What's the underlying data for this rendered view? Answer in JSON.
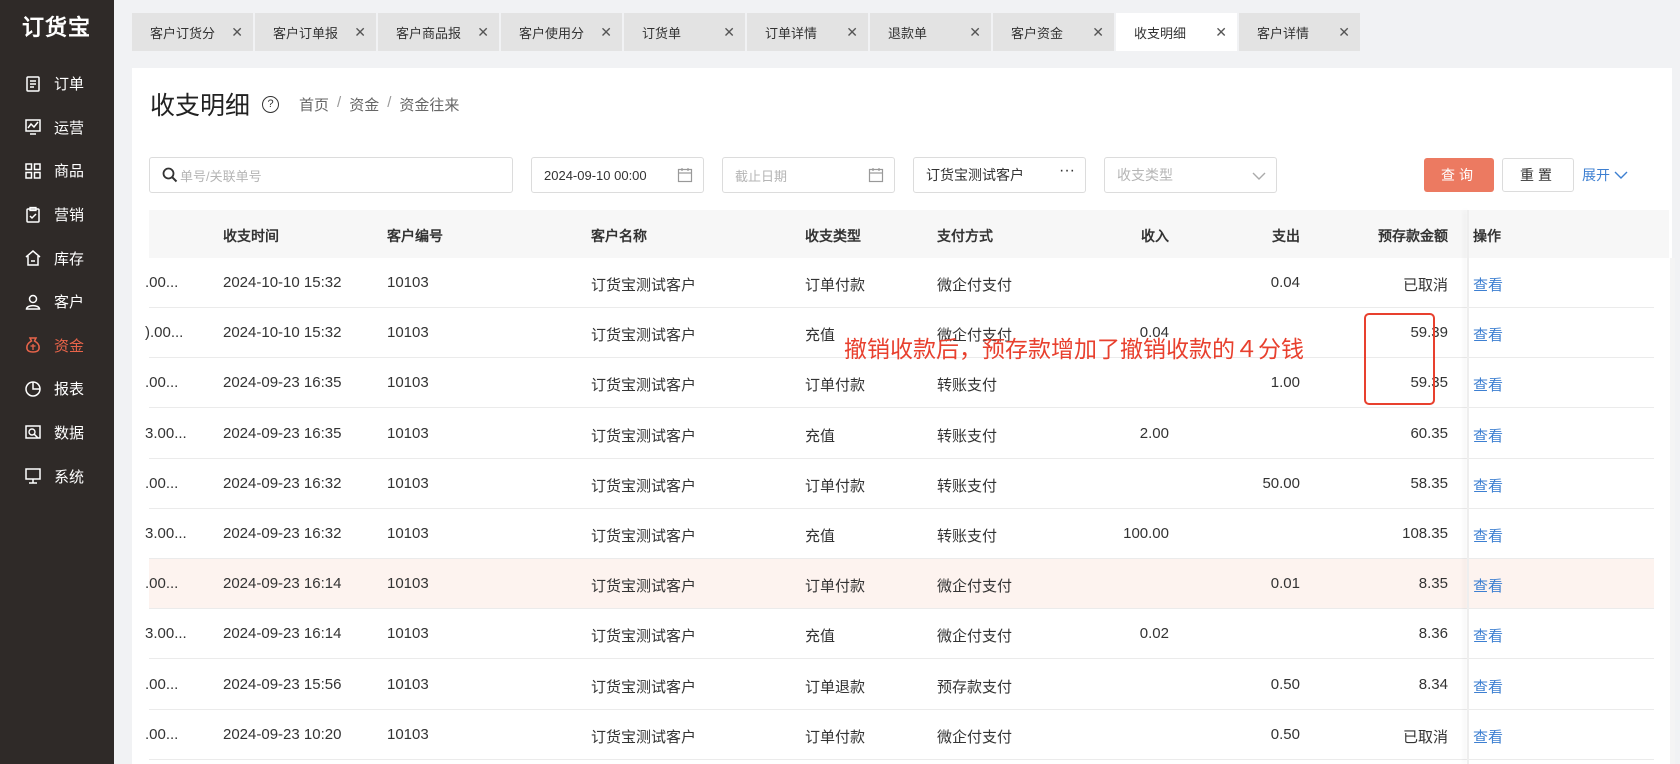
{
  "app": {
    "logo": "订货宝"
  },
  "sidebar": {
    "items": [
      {
        "label": "订单",
        "icon": "order-icon",
        "active": false
      },
      {
        "label": "运营",
        "icon": "operation-icon",
        "active": false
      },
      {
        "label": "商品",
        "icon": "product-icon",
        "active": false
      },
      {
        "label": "营销",
        "icon": "marketing-icon",
        "active": false
      },
      {
        "label": "库存",
        "icon": "inventory-icon",
        "active": false
      },
      {
        "label": "客户",
        "icon": "customer-icon",
        "active": false
      },
      {
        "label": "资金",
        "icon": "funds-icon",
        "active": true
      },
      {
        "label": "报表",
        "icon": "report-icon",
        "active": false
      },
      {
        "label": "数据",
        "icon": "data-icon",
        "active": false
      },
      {
        "label": "系统",
        "icon": "system-icon",
        "active": false
      }
    ]
  },
  "tabs": [
    {
      "label": "客户订货分",
      "active": false
    },
    {
      "label": "客户订单报",
      "active": false
    },
    {
      "label": "客户商品报",
      "active": false
    },
    {
      "label": "客户使用分",
      "active": false
    },
    {
      "label": "订货单",
      "active": false
    },
    {
      "label": "订单详情",
      "active": false
    },
    {
      "label": "退款单",
      "active": false
    },
    {
      "label": "客户资金",
      "active": false
    },
    {
      "label": "收支明细",
      "active": true
    },
    {
      "label": "客户详情",
      "active": false
    }
  ],
  "header": {
    "title": "收支明细",
    "help": "?",
    "breadcrumb": [
      "首页",
      "资金",
      "资金往来"
    ]
  },
  "filters": {
    "search_placeholder": "单号/关联单号",
    "start_date": "2024-09-10 00:00",
    "end_date_placeholder": "截止日期",
    "customer": "订货宝测试客户",
    "type_placeholder": "收支类型",
    "query_label": "查询",
    "reset_label": "重置",
    "expand_label": "展开"
  },
  "table": {
    "columns": [
      "收支时间",
      "客户编号",
      "客户名称",
      "收支类型",
      "支付方式",
      "收入",
      "支出",
      "预存款金额",
      "操作"
    ],
    "rows": [
      {
        "prefix": ".00...",
        "time": "2024-10-10 15:32",
        "code": "10103",
        "name": "订货宝测试客户",
        "type": "订单付款",
        "pay": "微企付支付",
        "income": "",
        "expense": "0.04",
        "balance": "已取消",
        "op": "查看",
        "highlight": false
      },
      {
        "prefix": ").00...",
        "time": "2024-10-10 15:32",
        "code": "10103",
        "name": "订货宝测试客户",
        "type": "充值",
        "pay": "微企付支付",
        "income": "0.04",
        "expense": "",
        "balance": "59.39",
        "op": "查看",
        "highlight": false
      },
      {
        "prefix": ".00...",
        "time": "2024-09-23 16:35",
        "code": "10103",
        "name": "订货宝测试客户",
        "type": "订单付款",
        "pay": "转账支付",
        "income": "",
        "expense": "1.00",
        "balance": "59.35",
        "op": "查看",
        "highlight": false
      },
      {
        "prefix": "3.00...",
        "time": "2024-09-23 16:35",
        "code": "10103",
        "name": "订货宝测试客户",
        "type": "充值",
        "pay": "转账支付",
        "income": "2.00",
        "expense": "",
        "balance": "60.35",
        "op": "查看",
        "highlight": false
      },
      {
        "prefix": ".00...",
        "time": "2024-09-23 16:32",
        "code": "10103",
        "name": "订货宝测试客户",
        "type": "订单付款",
        "pay": "转账支付",
        "income": "",
        "expense": "50.00",
        "balance": "58.35",
        "op": "查看",
        "highlight": false
      },
      {
        "prefix": "3.00...",
        "time": "2024-09-23 16:32",
        "code": "10103",
        "name": "订货宝测试客户",
        "type": "充值",
        "pay": "转账支付",
        "income": "100.00",
        "expense": "",
        "balance": "108.35",
        "op": "查看",
        "highlight": false
      },
      {
        "prefix": ".00...",
        "time": "2024-09-23 16:14",
        "code": "10103",
        "name": "订货宝测试客户",
        "type": "订单付款",
        "pay": "微企付支付",
        "income": "",
        "expense": "0.01",
        "balance": "8.35",
        "op": "查看",
        "highlight": true
      },
      {
        "prefix": "3.00...",
        "time": "2024-09-23 16:14",
        "code": "10103",
        "name": "订货宝测试客户",
        "type": "充值",
        "pay": "微企付支付",
        "income": "0.02",
        "expense": "",
        "balance": "8.36",
        "op": "查看",
        "highlight": false
      },
      {
        "prefix": ".00...",
        "time": "2024-09-23 15:56",
        "code": "10103",
        "name": "订货宝测试客户",
        "type": "订单退款",
        "pay": "预存款支付",
        "income": "",
        "expense": "0.50",
        "balance": "8.34",
        "op": "查看",
        "highlight": false
      },
      {
        "prefix": ".00...",
        "time": "2024-09-23 10:20",
        "code": "10103",
        "name": "订货宝测试客户",
        "type": "订单付款",
        "pay": "微企付支付",
        "income": "",
        "expense": "0.50",
        "balance": "已取消",
        "op": "查看",
        "highlight": false
      }
    ]
  },
  "annotation": {
    "text": "撤销收款后，预存款增加了撤销收款的４分钱",
    "color": "#e8402e"
  },
  "colors": {
    "accent": "#ec7a61",
    "link": "#3d7fd1",
    "sidebar": "#2f2a28"
  }
}
